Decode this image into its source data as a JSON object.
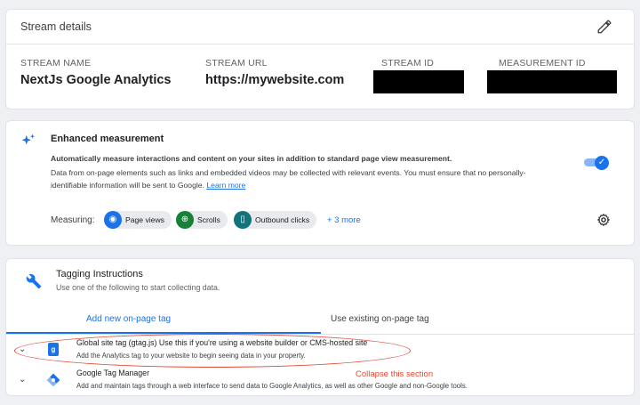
{
  "stream_details": {
    "title": "Stream details",
    "fields": [
      {
        "label": "STREAM NAME",
        "value": "NextJs Google Analytics"
      },
      {
        "label": "STREAM URL",
        "value": "https://mywebsite.com"
      },
      {
        "label": "STREAM ID",
        "value": ""
      },
      {
        "label": "MEASUREMENT ID",
        "value": ""
      }
    ]
  },
  "enhanced": {
    "title": "Enhanced measurement",
    "bold_line": "Automatically measure interactions and content on your sites in addition to standard page view measurement.",
    "desc": "Data from on-page elements such as links and embedded videos may be collected with relevant events. You must ensure that no personally-identifiable information will be sent to Google.",
    "learn_more": "Learn more",
    "toggle_on": true,
    "measuring_label": "Measuring:",
    "chips": [
      {
        "label": "Page views",
        "icon": "eye-icon",
        "color": "#1a73e8"
      },
      {
        "label": "Scrolls",
        "icon": "crosshair-icon",
        "color": "#188038"
      },
      {
        "label": "Outbound clicks",
        "icon": "mouse-icon",
        "color": "#12737a"
      }
    ],
    "more": "+ 3 more"
  },
  "tagging": {
    "title": "Tagging Instructions",
    "subtitle": "Use one of the following to start collecting data.",
    "tabs": [
      "Add new on-page tag",
      "Use existing on-page tag"
    ],
    "active_tab": 0,
    "rows": [
      {
        "title_bold": "Global site tag (gtag.js)",
        "title_rest": " Use this if you're using a website builder or CMS-hosted site",
        "subtitle": "Add the Analytics tag to your website to begin seeing data in your property."
      },
      {
        "title_bold": "Google Tag Manager",
        "title_rest": "",
        "subtitle": "Add and maintain tags through a web interface to send data to Google Analytics, as well as other Google and non-Google tools."
      }
    ],
    "annotation": "Collapse this section"
  },
  "colors": {
    "accent": "#1a73e8",
    "annotation": "#e04a35"
  }
}
